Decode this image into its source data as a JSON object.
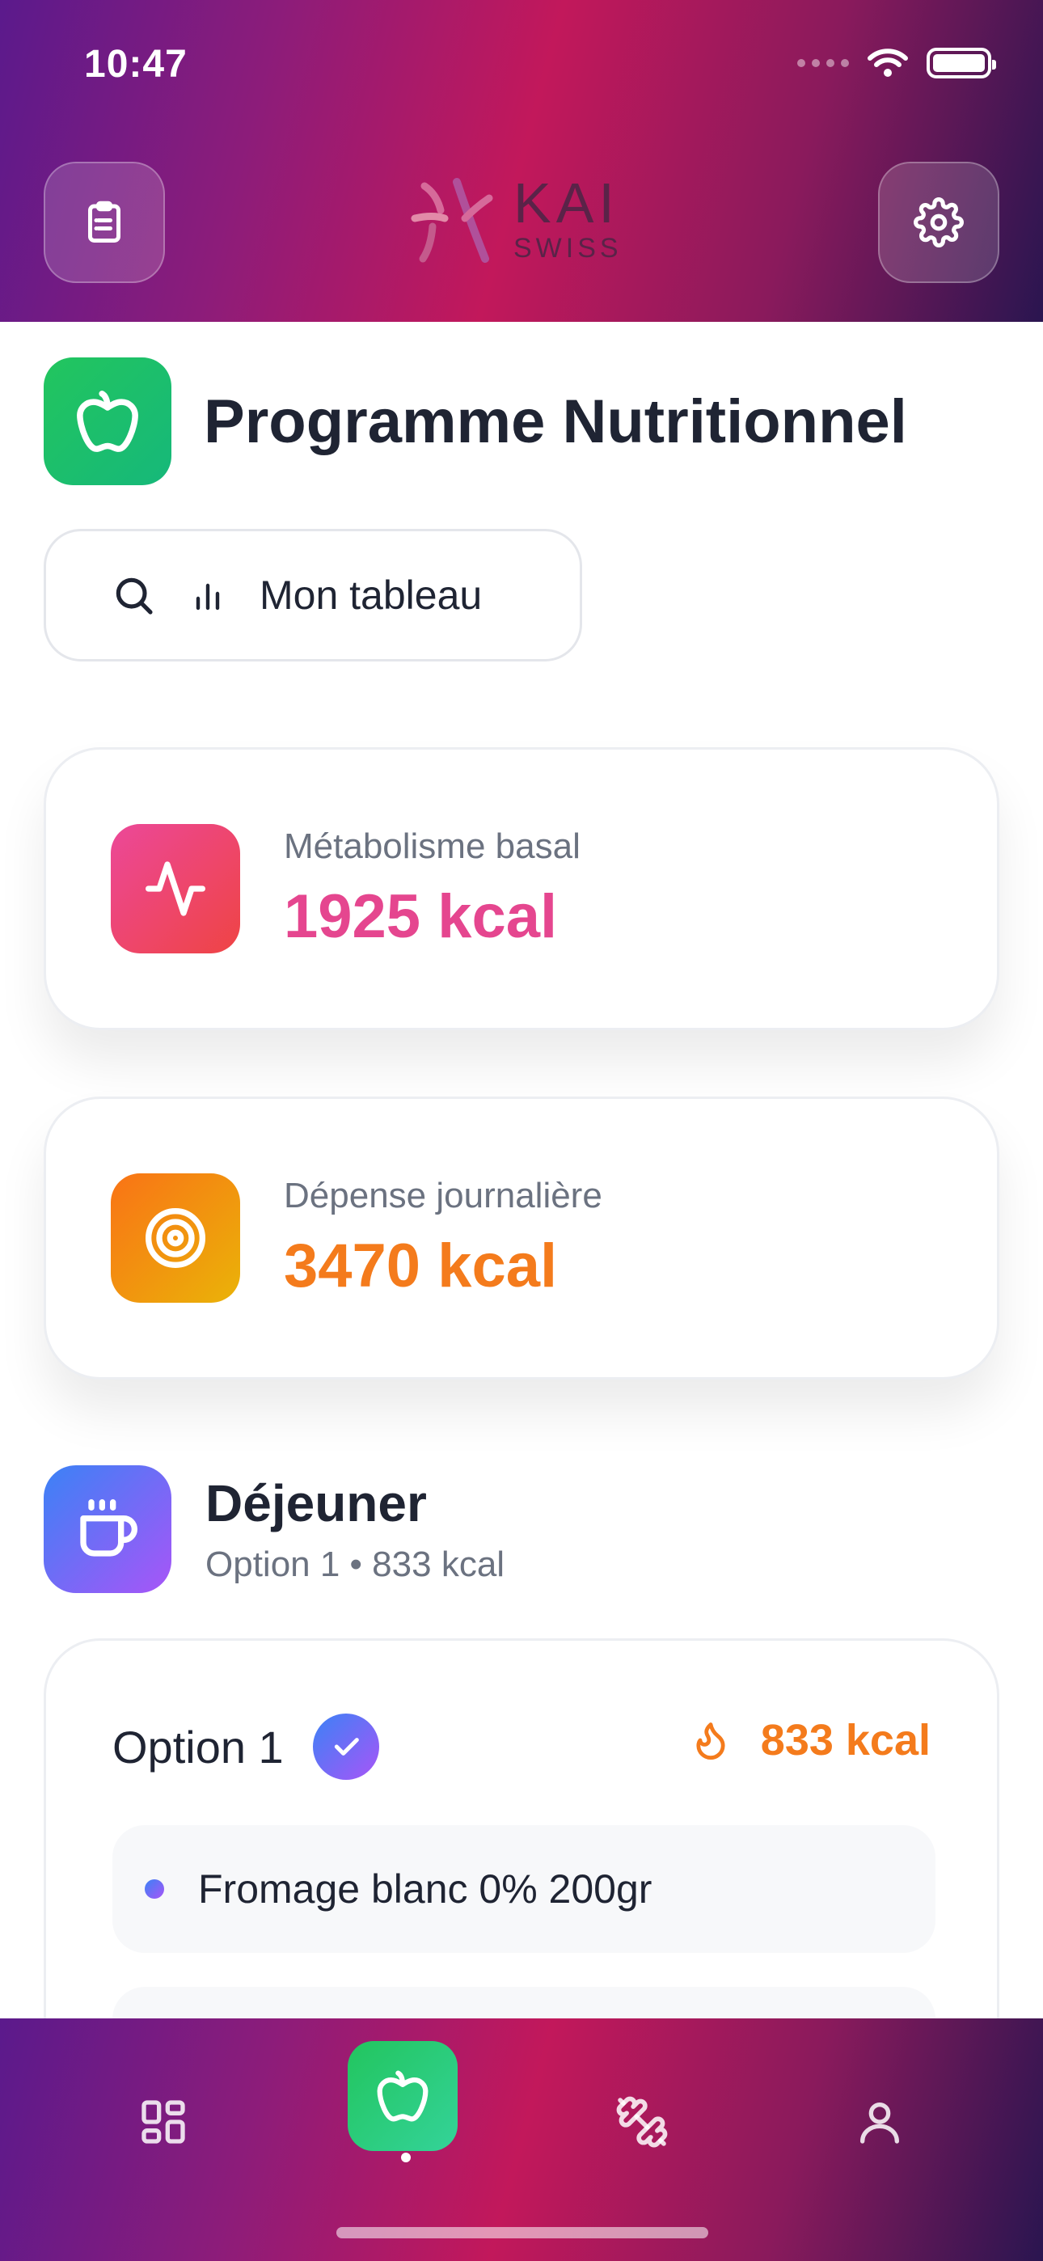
{
  "status_bar": {
    "time": "10:47"
  },
  "header": {
    "logo_primary": "KAI",
    "logo_secondary": "SWISS",
    "left_button_icon": "clipboard-icon",
    "right_button_icon": "gear-icon"
  },
  "page": {
    "title": "Programme Nutritionnel",
    "title_icon": "apple-icon"
  },
  "dashboard_button": {
    "label": "Mon tableau"
  },
  "stats": [
    {
      "label": "Métabolisme basal",
      "value": "1925 kcal",
      "icon": "activity-icon",
      "color": "#e5468f"
    },
    {
      "label": "Dépense journalière",
      "value": "3470 kcal",
      "icon": "target-icon",
      "color": "#f47b1c"
    }
  ],
  "meal": {
    "title": "Déjeuner",
    "subtitle": "Option 1 • 833 kcal",
    "icon": "coffee-cup-icon",
    "option": {
      "title": "Option 1",
      "kcal": "833 kcal",
      "items": [
        {
          "label": "Fromage blanc 0% 200gr"
        },
        {
          "label": ""
        }
      ]
    }
  },
  "bottom_nav": {
    "items": [
      {
        "name": "dashboard",
        "icon": "grid-icon"
      },
      {
        "name": "nutrition",
        "icon": "apple-icon",
        "active": true
      },
      {
        "name": "workout",
        "icon": "dumbbell-icon"
      },
      {
        "name": "profile",
        "icon": "user-icon"
      }
    ]
  },
  "colors": {
    "accent_green": "#22c55e",
    "accent_pink": "#e5468f",
    "accent_orange": "#f47b1c",
    "accent_purple": "#a855f7"
  }
}
